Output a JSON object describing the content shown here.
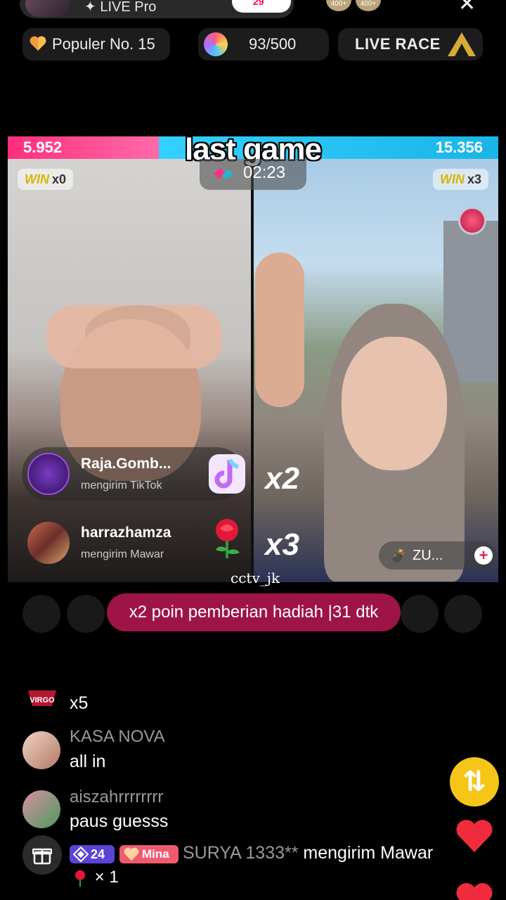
{
  "header": {
    "live_label": "✦ LIVE Pro",
    "heart_count": "29",
    "viewer_badges": [
      "400+",
      "400+"
    ]
  },
  "pills": {
    "rank": "Populer No. 15",
    "goal": "93/500",
    "race": "LIVE RACE"
  },
  "battle": {
    "title": "last game",
    "score_left": "5.952",
    "score_right": "15.356",
    "win_left": {
      "label": "WIN",
      "count": "x0"
    },
    "win_right": {
      "label": "WIN",
      "count": "x3"
    },
    "timer": "02:23",
    "multiplier_1": "x2",
    "multiplier_2": "x3",
    "zu_label": "ZU...",
    "gifts": [
      {
        "name": "Raja.Gomb...",
        "action": "mengirim TikTok"
      },
      {
        "name": "harrazhamza",
        "action": "mengirim Mawar"
      }
    ],
    "watermark": "cctv_jk"
  },
  "bonus_banner": "x2 poin pemberian hadiah  |31 dtk",
  "comments": [
    {
      "name": "",
      "text": "x5"
    },
    {
      "name": "KASA NOVA",
      "text": "all in"
    },
    {
      "name": "aiszahrrrrrrrr",
      "text": "paus guesss"
    }
  ],
  "gift_message": {
    "level": "24",
    "fan_badge": "Mina",
    "name": "SURYA 1333**",
    "action": " mengirim Mawar",
    "count": "× 1"
  },
  "colors": {
    "pk_left": "#ff2e7e",
    "pk_right": "#34d0ff",
    "banner": "#9e1447",
    "repost": "#f5c518"
  }
}
